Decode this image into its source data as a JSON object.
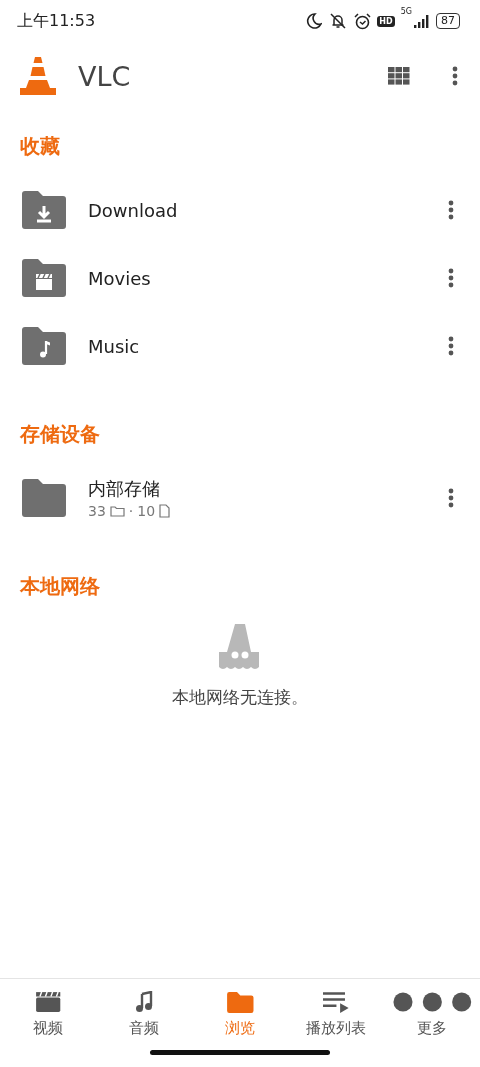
{
  "status_bar": {
    "time": "上午11:53",
    "hd_badge": "HD",
    "network": "5G",
    "battery": "87"
  },
  "app_bar": {
    "title": "VLC"
  },
  "favorites": {
    "title": "收藏",
    "items": [
      {
        "name": "Download",
        "kind": "download"
      },
      {
        "name": "Movies",
        "kind": "movies"
      },
      {
        "name": "Music",
        "kind": "music"
      }
    ]
  },
  "storage": {
    "title": "存储设备",
    "items": [
      {
        "name": "内部存储",
        "folders": "33",
        "separator": "·",
        "files": "10"
      }
    ]
  },
  "local_network": {
    "title": "本地网络",
    "message": "本地网络无连接。"
  },
  "bottom_nav": [
    {
      "label": "视频",
      "kind": "video",
      "selected": false
    },
    {
      "label": "音频",
      "kind": "audio",
      "selected": false
    },
    {
      "label": "浏览",
      "kind": "browse",
      "selected": true
    },
    {
      "label": "播放列表",
      "kind": "playlist",
      "selected": false
    },
    {
      "label": "更多",
      "kind": "more",
      "selected": false
    }
  ]
}
